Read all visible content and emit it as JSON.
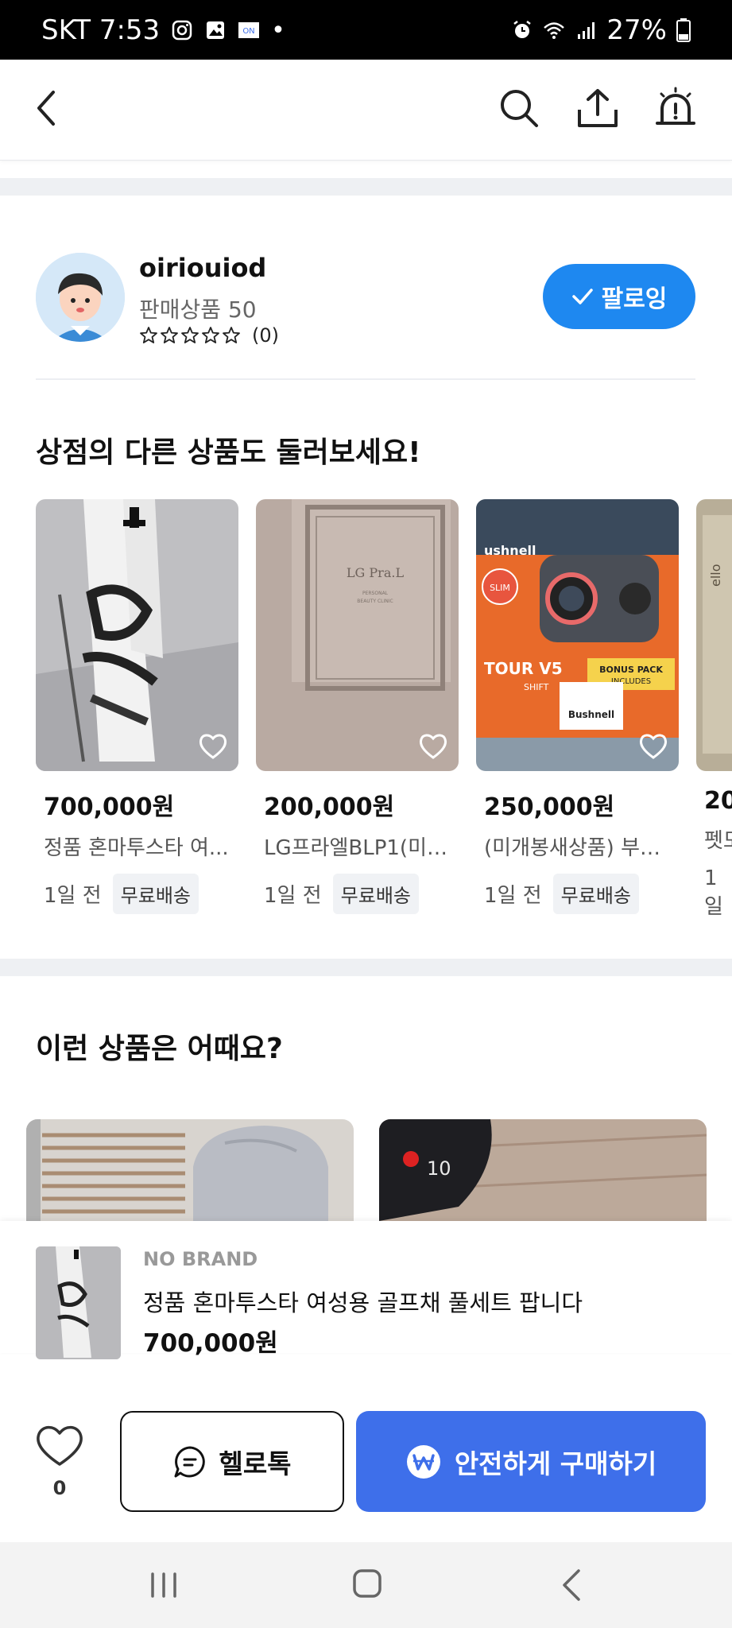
{
  "status_bar": {
    "carrier_time": "SKT 7:53",
    "battery": "27%"
  },
  "app_bar": {
    "icons": [
      "back-icon",
      "search-icon",
      "share-icon",
      "report-icon"
    ]
  },
  "seller": {
    "name": "oiriouiod",
    "products_label": "판매상품 50",
    "rating_count": "(0)",
    "rating_stars": 0,
    "follow_label": "팔로잉"
  },
  "store_section": {
    "title": "상점의 다른 상품도 둘러보세요!",
    "items": [
      {
        "price": "700,000원",
        "title": "정품 혼마투스타 여...",
        "time": "1일 전",
        "badge": "무료배송"
      },
      {
        "price": "200,000원",
        "title": "LG프라엘BLP1(미개...",
        "time": "1일 전",
        "badge": "무료배송"
      },
      {
        "price": "250,000원",
        "title": "(미개봉새상품) 부쉬...",
        "time": "1일 전",
        "badge": "무료배송"
      },
      {
        "price": "20",
        "title": "펫모",
        "time": "1일",
        "badge": ""
      }
    ]
  },
  "recommend_section": {
    "title": "이런 상품은 어때요?"
  },
  "summary": {
    "brand": "NO BRAND",
    "title": "정품 혼마투스타 여성용 골프채 풀세트 팝니다",
    "price": "700,000원"
  },
  "actions": {
    "like_count": "0",
    "chat_label": "헬로톡",
    "buy_label": "안전하게 구매하기"
  },
  "colors": {
    "accent_blue": "#1e88f0",
    "buy_blue": "#3e6fea"
  }
}
